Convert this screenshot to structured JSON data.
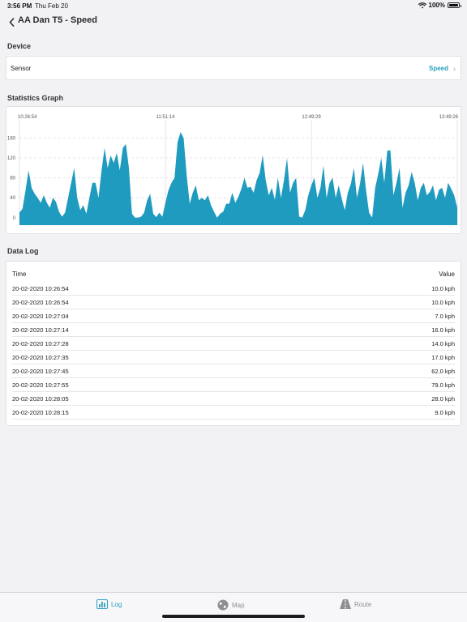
{
  "status_bar": {
    "time": "3:56 PM",
    "date": "Thu Feb 20",
    "battery": "100%"
  },
  "nav": {
    "title": "AA Dan T5 - Speed"
  },
  "device": {
    "header": "Device",
    "sensor_label": "Sensor",
    "sensor_value": "Speed"
  },
  "graph": {
    "header": "Statistics Graph"
  },
  "chart_data": {
    "type": "area",
    "x_ticks": [
      "10:26:54",
      "11:51:14",
      "12:49:29",
      "13:49:26"
    ],
    "y_ticks": [
      0,
      40,
      80,
      120,
      160
    ],
    "ylim": [
      -15,
      190
    ],
    "color": "#1f9bbf",
    "grid": true,
    "values": [
      10,
      18,
      55,
      95,
      60,
      48,
      40,
      30,
      45,
      30,
      20,
      40,
      32,
      12,
      2,
      10,
      40,
      70,
      100,
      40,
      15,
      25,
      8,
      40,
      70,
      70,
      40,
      95,
      140,
      100,
      125,
      110,
      130,
      95,
      140,
      148,
      100,
      8,
      0,
      0,
      2,
      10,
      35,
      48,
      8,
      1,
      10,
      2,
      30,
      55,
      70,
      80,
      152,
      172,
      160,
      85,
      28,
      50,
      65,
      35,
      40,
      35,
      45,
      25,
      12,
      0,
      8,
      12,
      28,
      28,
      50,
      30,
      42,
      58,
      80,
      60,
      62,
      50,
      75,
      90,
      126,
      75,
      45,
      60,
      36,
      80,
      40,
      75,
      120,
      50,
      70,
      80,
      2,
      0,
      15,
      45,
      65,
      80,
      40,
      60,
      105,
      40,
      70,
      80,
      40,
      65,
      38,
      15,
      50,
      68,
      100,
      40,
      68,
      110,
      55,
      10,
      0,
      60,
      88,
      120,
      70,
      135,
      135,
      45,
      70,
      100,
      20,
      50,
      65,
      92,
      70,
      35,
      60,
      70,
      45,
      52,
      65,
      35,
      56,
      60,
      40,
      70,
      58,
      45,
      20
    ],
    "series": []
  },
  "log": {
    "header": "Data Log",
    "col_time": "Time",
    "col_value": "Value",
    "rows": [
      {
        "time": "20-02-2020 10:26:54",
        "value": "10.0 kph"
      },
      {
        "time": "20-02-2020 10:26:54",
        "value": "10.0 kph"
      },
      {
        "time": "20-02-2020 10:27:04",
        "value": "7.0 kph"
      },
      {
        "time": "20-02-2020 10:27:14",
        "value": "16.0 kph"
      },
      {
        "time": "20-02-2020 10:27:28",
        "value": "14.0 kph"
      },
      {
        "time": "20-02-2020 10:27:35",
        "value": "17.0 kph"
      },
      {
        "time": "20-02-2020 10:27:45",
        "value": "62.0 kph"
      },
      {
        "time": "20-02-2020 10:27:55",
        "value": "79.0 kph"
      },
      {
        "time": "20-02-2020 10:28:05",
        "value": "28.0 kph"
      },
      {
        "time": "20-02-2020 10:28:15",
        "value": "9.0 kph"
      }
    ]
  },
  "tabs": [
    {
      "label": "Log",
      "icon": "bar-chart-icon",
      "active": true
    },
    {
      "label": "Map",
      "icon": "globe-icon",
      "active": false
    },
    {
      "label": "Route",
      "icon": "road-icon",
      "active": false
    }
  ],
  "colors": {
    "accent": "#2b9fbf",
    "chart_fill": "#1f9bbf"
  }
}
